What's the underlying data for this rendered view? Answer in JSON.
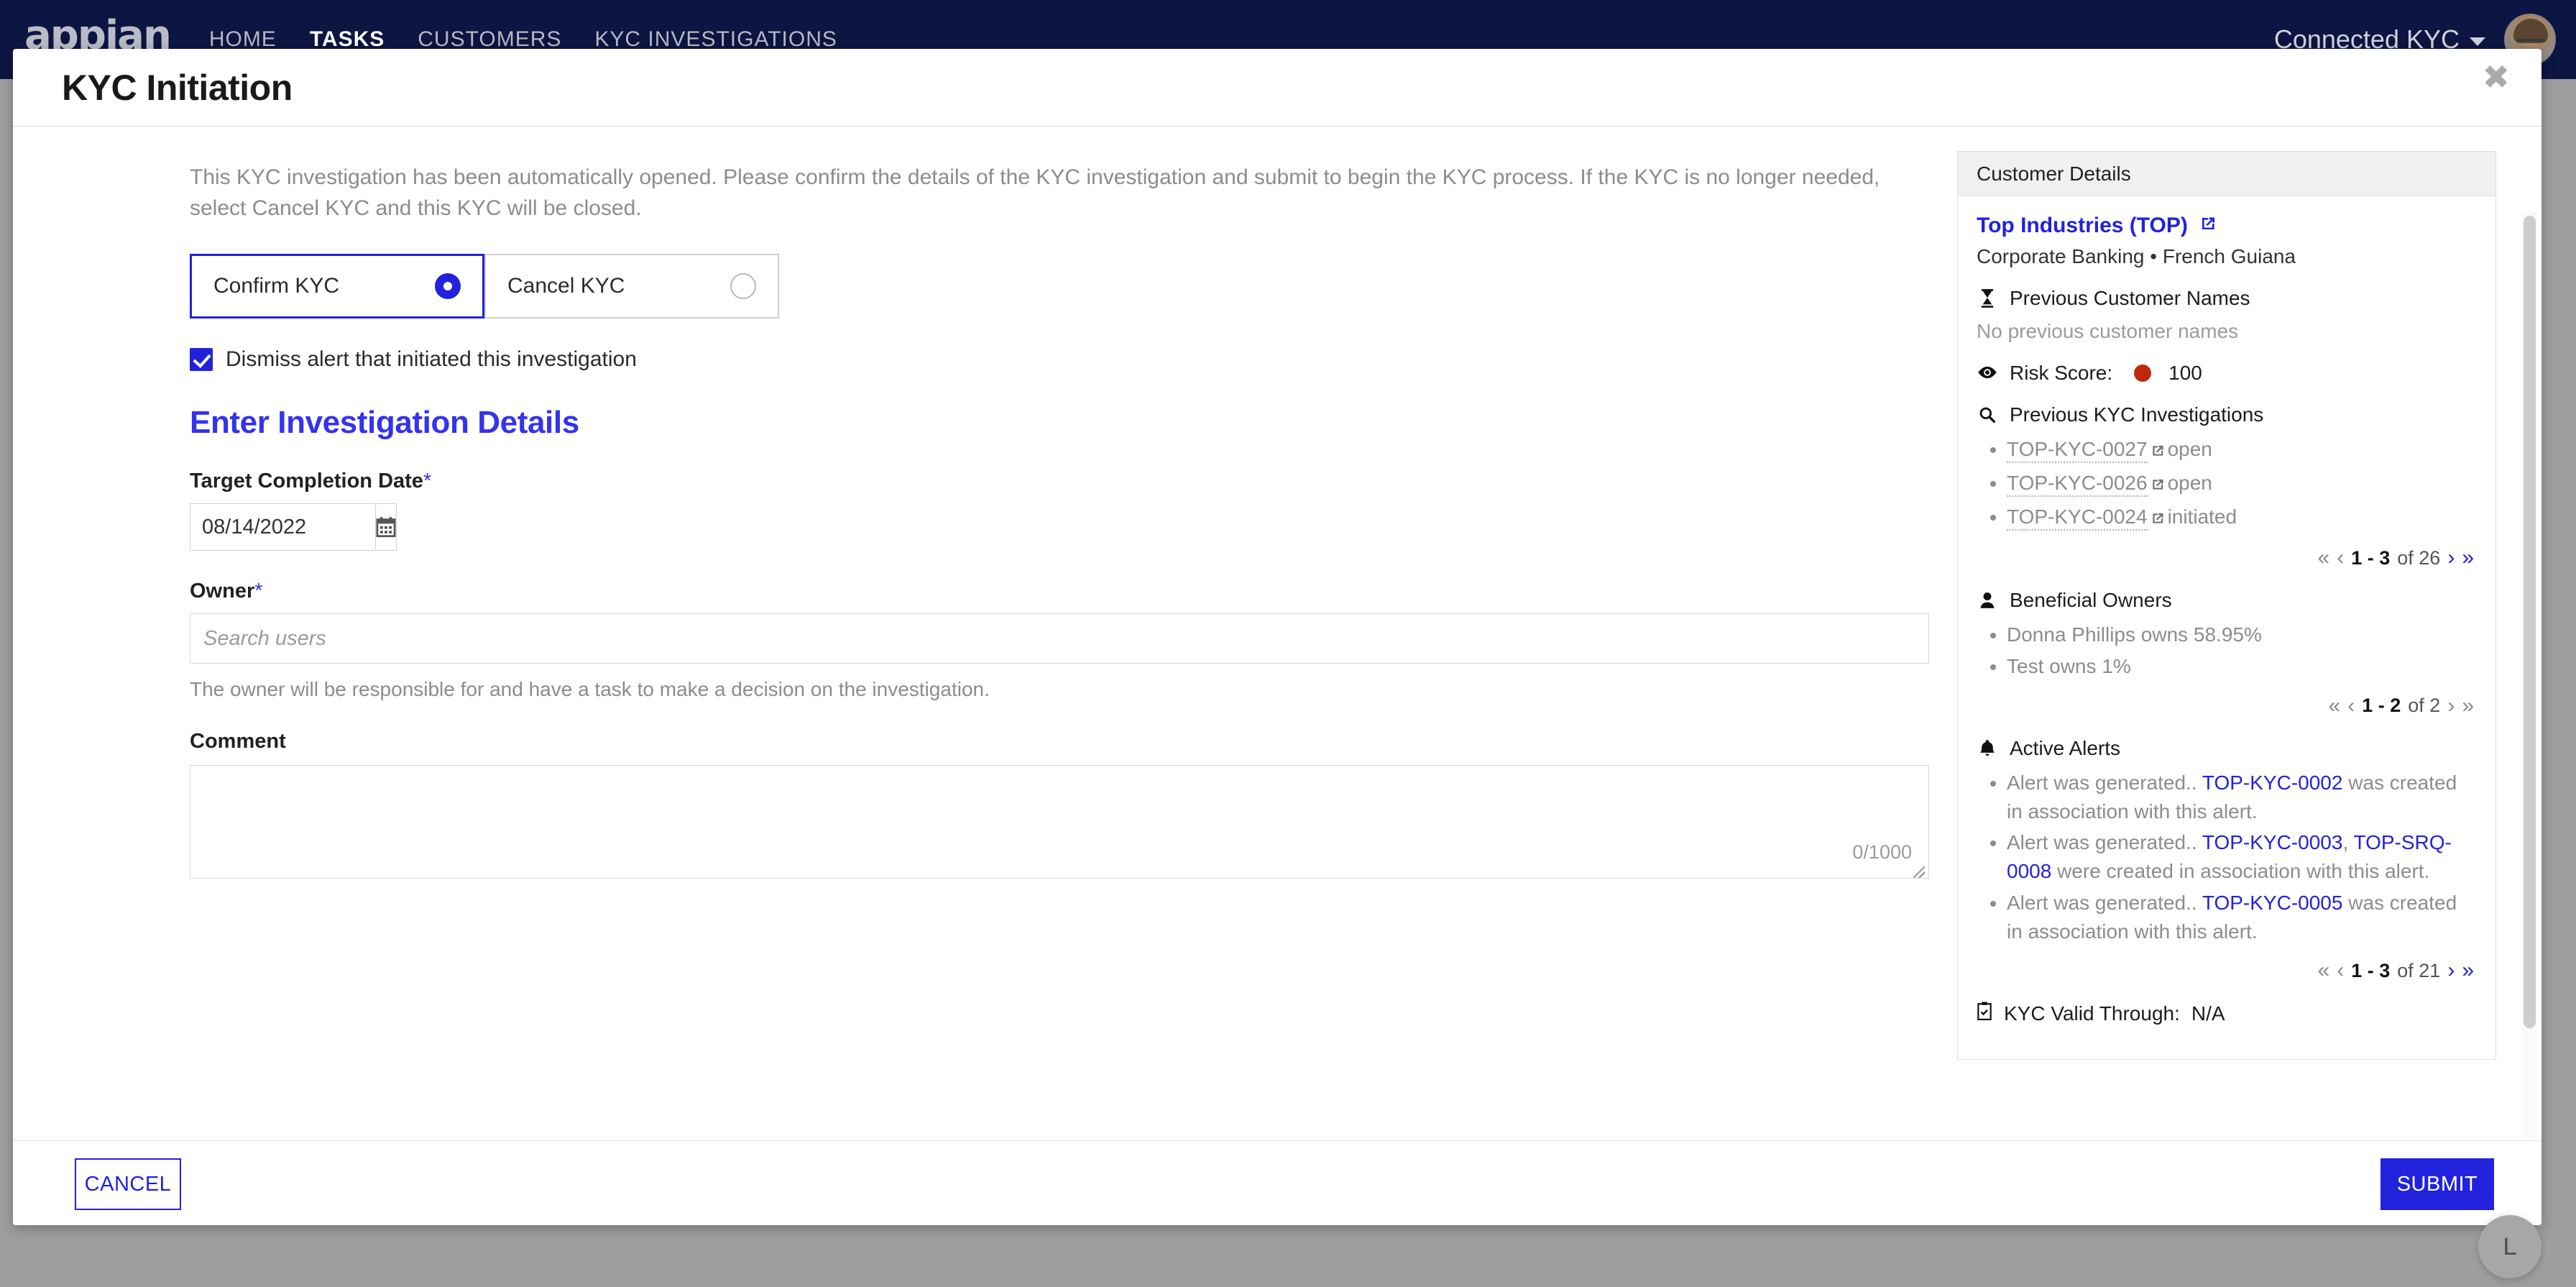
{
  "topnav": {
    "logo": "appian",
    "links": [
      {
        "label": "HOME",
        "active": false
      },
      {
        "label": "TASKS",
        "active": true
      },
      {
        "label": "CUSTOMERS",
        "active": false
      },
      {
        "label": "KYC INVESTIGATIONS",
        "active": false
      }
    ],
    "account_label": "Connected KYC",
    "brand_bg": "#0d1542"
  },
  "modal": {
    "title": "KYC Initiation",
    "close_label": "✖",
    "intro": "This KYC investigation has been automatically opened. Please confirm the details of the KYC investigation and submit to begin the KYC process. If the KYC is no longer needed, select Cancel KYC and this KYC will be closed."
  },
  "decision": {
    "confirm_label": "Confirm KYC",
    "cancel_label": "Cancel KYC",
    "selected": "Confirm KYC",
    "dismiss_label": "Dismiss alert that initiated this investigation",
    "dismiss_checked": true
  },
  "form": {
    "section_title": "Enter Investigation Details",
    "date_label": "Target Completion Date",
    "date_value": "08/14/2022",
    "owner_label": "Owner",
    "owner_value": "",
    "owner_placeholder": "Search users",
    "owner_help": "The owner will be responsible for and have a task to make a decision on the investigation.",
    "comment_label": "Comment",
    "comment_value": "",
    "char_count": "0/1000",
    "required_mark": "*"
  },
  "sidebar": {
    "header": "Customer Details",
    "customer_name": "Top Industries (TOP)",
    "customer_sub": "Corporate Banking • French Guiana",
    "previous_names_heading": "Previous Customer Names",
    "previous_names_empty": "No previous customer names",
    "risk_label": "Risk Score:",
    "risk_value": "100",
    "risk_color": "#c0280c",
    "prev_kyc_heading": "Previous KYC Investigations",
    "prev_kyc_items": [
      {
        "id": "TOP-KYC-0027",
        "status": "open"
      },
      {
        "id": "TOP-KYC-0026",
        "status": "open"
      },
      {
        "id": "TOP-KYC-0024",
        "status": "initiated"
      }
    ],
    "prev_kyc_pager": {
      "range": "1 - 3",
      "of": "of 26"
    },
    "owners_heading": "Beneficial Owners",
    "owners_items": [
      "Donna Phillips owns 58.95%",
      "Test owns 1%"
    ],
    "owners_pager": {
      "range": "1 - 2",
      "of": "of 2"
    },
    "alerts_heading": "Active Alerts",
    "alerts_items": [
      {
        "pre": "Alert was generated.. ",
        "links": [
          "TOP-KYC-0002"
        ],
        "post": " was created in association with this alert."
      },
      {
        "pre": "Alert was generated.. ",
        "links": [
          "TOP-KYC-0003",
          "TOP-SRQ-0008"
        ],
        "post": " were created in association with this alert."
      },
      {
        "pre": "Alert was generated.. ",
        "links": [
          "TOP-KYC-0005"
        ],
        "post": " was created in association with this alert."
      }
    ],
    "alerts_pager": {
      "range": "1 - 3",
      "of": "of 21"
    },
    "valid_label": "KYC Valid Through:",
    "valid_value": "N/A",
    "pager_glyphs": {
      "first": "«",
      "prev": "‹",
      "next": "›",
      "last": "»"
    }
  },
  "footer": {
    "cancel_label": "CANCEL",
    "submit_label": "SUBMIT",
    "accent": "#2222dd"
  },
  "fab": {
    "label": "L"
  }
}
